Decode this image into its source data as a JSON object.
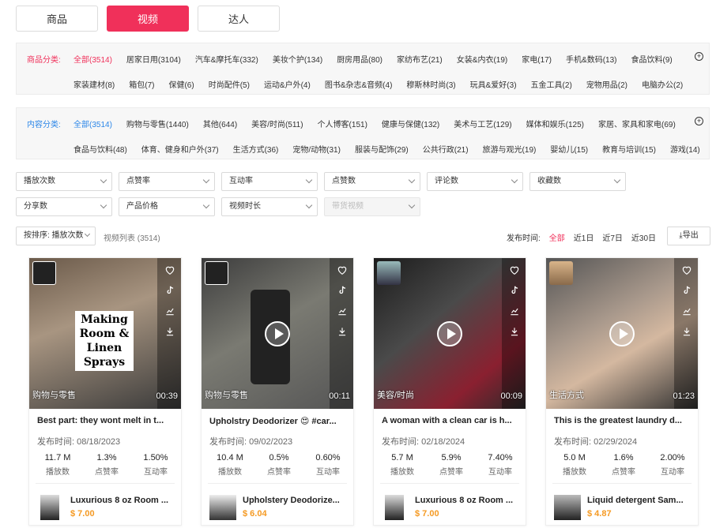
{
  "tabs": [
    "商品",
    "视频",
    "达人"
  ],
  "category": {
    "label": "商品分类:",
    "row1": [
      "全部(3514)",
      "居家日用(3104)",
      "汽车&摩托车(332)",
      "美妆个护(134)",
      "厨房用品(80)",
      "家纺布艺(21)",
      "女装&内衣(19)",
      "家电(17)",
      "手机&数码(13)",
      "食品饮料(9)"
    ],
    "row2": [
      "家装建材(8)",
      "箱包(7)",
      "保健(6)",
      "时尚配件(5)",
      "运动&户外(4)",
      "图书&杂志&音频(4)",
      "穆斯林时尚(3)",
      "玩具&爱好(3)",
      "五金工具(2)",
      "宠物用品(2)",
      "电脑办公(2)"
    ]
  },
  "content": {
    "label": "内容分类:",
    "row1": [
      "全部(3514)",
      "购物与零售(1440)",
      "其他(644)",
      "美容/时尚(511)",
      "个人博客(151)",
      "健康与保健(132)",
      "美术与工艺(129)",
      "媒体和娱乐(125)",
      "家居、家具和家电(69)"
    ],
    "row2": [
      "食品与饮料(48)",
      "体育、健身和户外(37)",
      "生活方式(36)",
      "宠物/动物(31)",
      "服装与配饰(29)",
      "公共行政(21)",
      "旅游与观光(19)",
      "婴幼儿(15)",
      "教育与培训(15)",
      "游戏(14)"
    ]
  },
  "filters": {
    "row1": [
      "播放次数",
      "点赞率",
      "互动率",
      "点赞数",
      "评论数",
      "收藏数"
    ],
    "row2": [
      "分享数",
      "产品价格",
      "视频时长",
      "带货视频"
    ]
  },
  "sort": {
    "label": "按排序: 播放次数",
    "count": "视频列表 (3514)",
    "time_label": "发布时间:",
    "time_options": [
      "全部",
      "近1日",
      "近7日",
      "近30日"
    ],
    "export": "导出"
  },
  "cards": [
    {
      "category": "购物与零售",
      "duration": "00:39",
      "title": "Best part: they wont melt in t...",
      "date": "发布时间: 08/18/2023",
      "plays": "11.7 M",
      "like_rate": "1.3%",
      "engage_rate": "1.50%",
      "plays_label": "播放数",
      "like_label": "点赞率",
      "engage_label": "互动率",
      "product": "Luxurious 8 oz Room ...",
      "price": "$ 7.00",
      "overlay": "Making Room & Linen Sprays"
    },
    {
      "category": "购物与零售",
      "duration": "00:11",
      "title": "Upholstry Deodorizer 😍 #car...",
      "date": "发布时间: 09/02/2023",
      "plays": "10.4 M",
      "like_rate": "0.5%",
      "engage_rate": "0.60%",
      "plays_label": "播放数",
      "like_label": "点赞率",
      "engage_label": "互动率",
      "product": "Upholstery Deodorize...",
      "price": "$ 6.04"
    },
    {
      "category": "美容/时尚",
      "duration": "00:09",
      "title": "A woman with a clean car is h...",
      "date": "发布时间: 02/18/2024",
      "plays": "5.7 M",
      "like_rate": "5.9%",
      "engage_rate": "7.40%",
      "plays_label": "播放数",
      "like_label": "点赞率",
      "engage_label": "互动率",
      "product": "Luxurious 8 oz Room ...",
      "price": "$ 7.00"
    },
    {
      "category": "生活方式",
      "duration": "01:23",
      "title": "This is the greatest laundry d...",
      "date": "发布时间: 02/29/2024",
      "plays": "5.0 M",
      "like_rate": "1.6%",
      "engage_rate": "2.00%",
      "plays_label": "播放数",
      "like_label": "点赞率",
      "engage_label": "互动率",
      "product": "Liquid detergent Sam...",
      "price": "$ 4.87"
    }
  ]
}
